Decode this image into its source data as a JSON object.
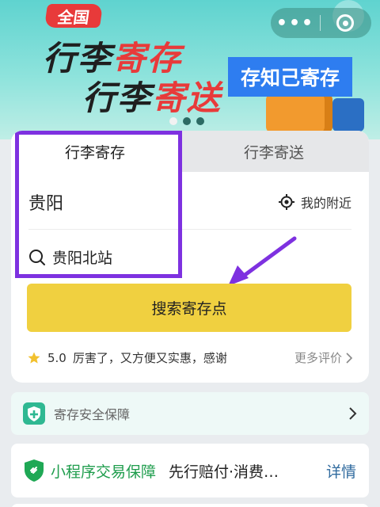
{
  "banner": {
    "badge": "全国",
    "line1_a": "行李",
    "line1_b": "寄存",
    "line2_a": "行李",
    "line2_b": "寄送",
    "tag": "存知己寄存",
    "slides": 3,
    "active_slide": 1
  },
  "capsule": {
    "more_label": "•••",
    "more_icon": "more-dots-icon",
    "close_icon": "close-circle-icon"
  },
  "tabs": {
    "storage": "行李寄存",
    "delivery": "行李寄送",
    "active": "storage"
  },
  "search": {
    "city": "贵阳",
    "nearby_label": "我的附近",
    "station": "贵阳北站",
    "button_label": "搜索寄存点"
  },
  "rating": {
    "score": "5.0",
    "review": "厉害了，又方便又实惠，感谢",
    "more_label": "更多评价"
  },
  "safety": {
    "label": "寄存安全保障"
  },
  "guarantee": {
    "title": "小程序交易保障",
    "desc": "先行赔付·消费…",
    "detail": "详情"
  },
  "colors": {
    "accent_yellow": "#f0d040",
    "highlight_purple": "#7e31e0",
    "green": "#1f9d4d",
    "banner_teal": "#5fd3cf"
  }
}
